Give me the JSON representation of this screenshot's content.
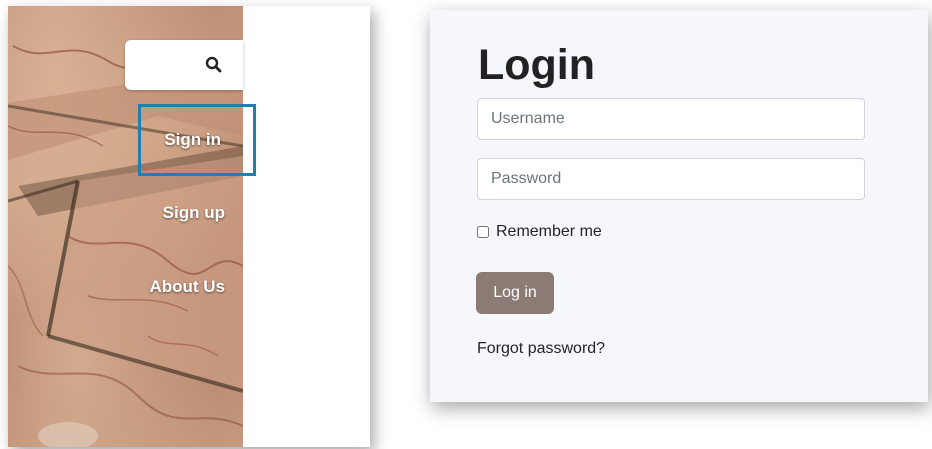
{
  "sidebar": {
    "search": {
      "icon": "search-icon"
    },
    "items": [
      {
        "label": "Sign in",
        "active": true
      },
      {
        "label": "Sign up",
        "active": false
      },
      {
        "label": "About Us",
        "active": false
      }
    ],
    "highlight_color": "#1e7fb3"
  },
  "login": {
    "title": "Login",
    "username_placeholder": "Username",
    "password_placeholder": "Password",
    "remember_label": "Remember me",
    "remember_checked": false,
    "login_button_label": "Log in",
    "forgot_label": "Forgot password?",
    "button_color": "#8c7a74",
    "panel_color": "#f6f7fc"
  }
}
